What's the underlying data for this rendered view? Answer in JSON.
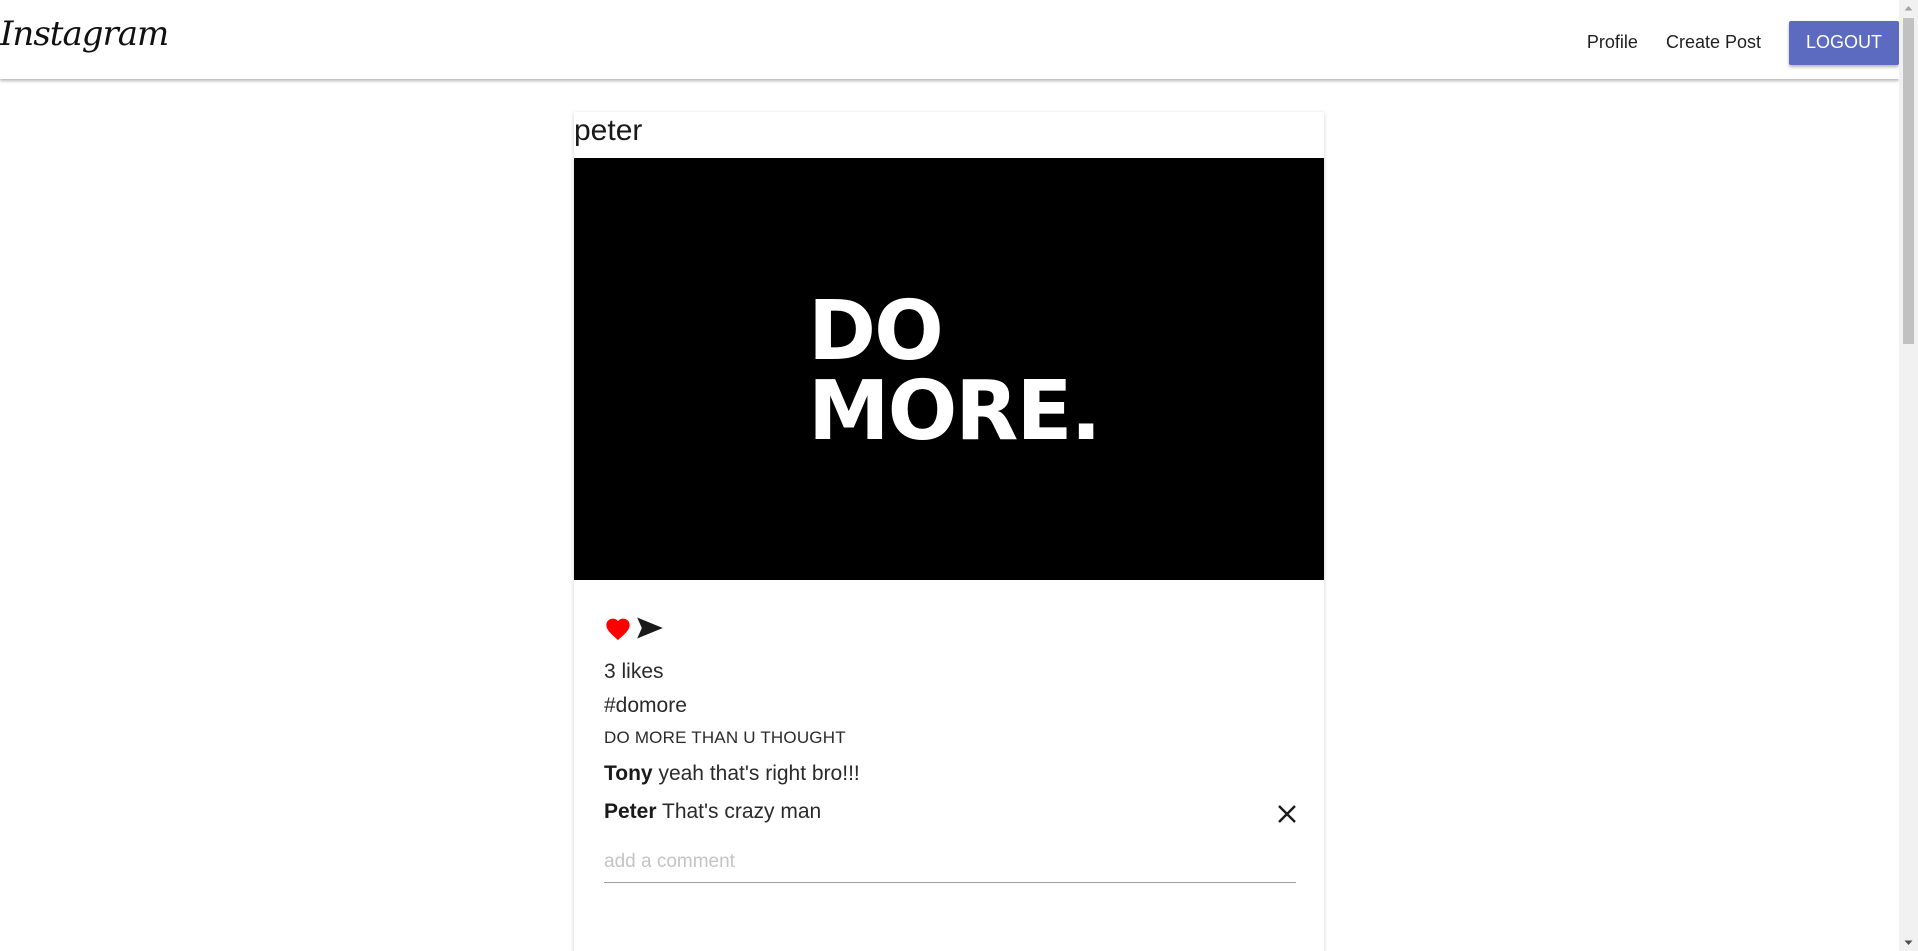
{
  "navbar": {
    "brand": "Instagram",
    "links": [
      "Profile",
      "Create Post"
    ],
    "logout_label": "LOGOUT",
    "logout_color": "#5c6bc0"
  },
  "post": {
    "username": "peter",
    "image_text": [
      "DO",
      "MORE."
    ],
    "liked": true,
    "like_icon": "heart-icon",
    "share_icon": "send-icon",
    "like_color": "#ff0000",
    "likes_text": "3 likes",
    "title": "#domore",
    "body": "DO MORE THAN U THOUGHT",
    "comments": [
      {
        "author": "Tony",
        "text": "yeah that's right bro!!!",
        "deletable": false
      },
      {
        "author": "Peter",
        "text": "That's crazy man",
        "deletable": true
      }
    ],
    "comment_placeholder": "add a comment"
  }
}
